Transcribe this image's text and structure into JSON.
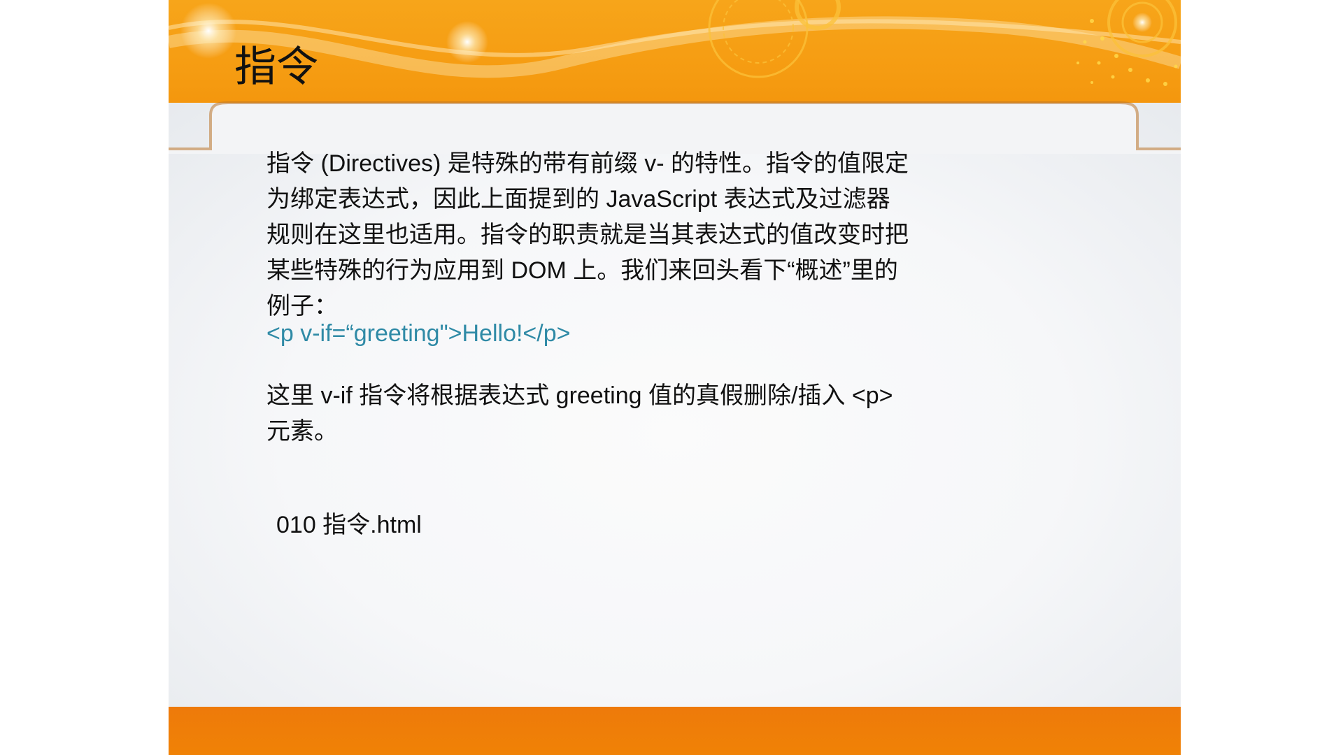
{
  "slide": {
    "title": "指令",
    "paragraph1": "指令 (Directives) 是特殊的带有前缀 v- 的特性。指令的值限定为绑定表达式，因此上面提到的 JavaScript 表达式及过滤器规则在这里也适用。指令的职责就是当其表达式的值改变时把某些特殊的行为应用到 DOM 上。我们来回头看下“概述”里的例子：",
    "code_example": "<p v-if=“greeting\">Hello!</p>",
    "paragraph2": "这里 v-if 指令将根据表达式 greeting 值的真假删除/插入 <p> 元素。",
    "file_reference": "010 指令.html"
  },
  "colors": {
    "banner_orange": "#f59a10",
    "footer_orange": "#ee7a0a",
    "code_teal": "#2f8aa6",
    "text": "#111111"
  }
}
